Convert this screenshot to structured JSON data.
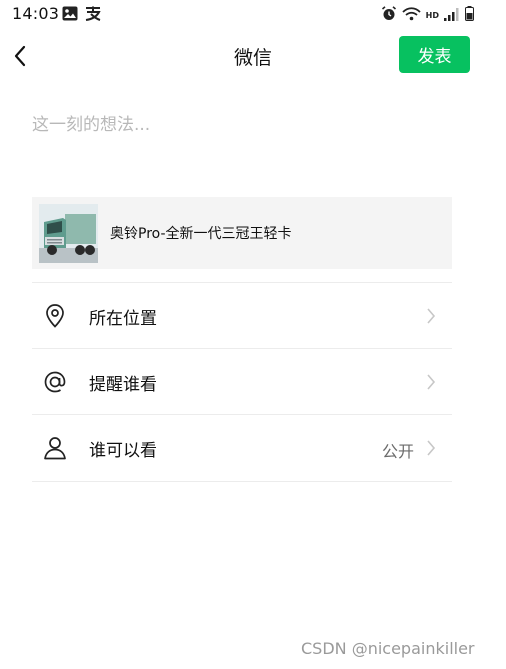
{
  "status_bar": {
    "time": "14:03",
    "hd_label": "HD"
  },
  "nav": {
    "title": "微信",
    "publish_label": "发表"
  },
  "composer": {
    "placeholder": "这一刻的想法..."
  },
  "link_card": {
    "title": "奥铃Pro-全新一代三冠王轻卡"
  },
  "options": [
    {
      "label": "所在位置",
      "icon": "location-pin-icon",
      "value": ""
    },
    {
      "label": "提醒谁看",
      "icon": "at-sign-icon",
      "value": ""
    },
    {
      "label": "谁可以看",
      "icon": "person-icon",
      "value": "公开"
    }
  ],
  "watermark": "CSDN @nicepainkiller",
  "colors": {
    "accent": "#07c160",
    "card_bg": "#f4f4f4",
    "placeholder": "#b8b8b8"
  }
}
